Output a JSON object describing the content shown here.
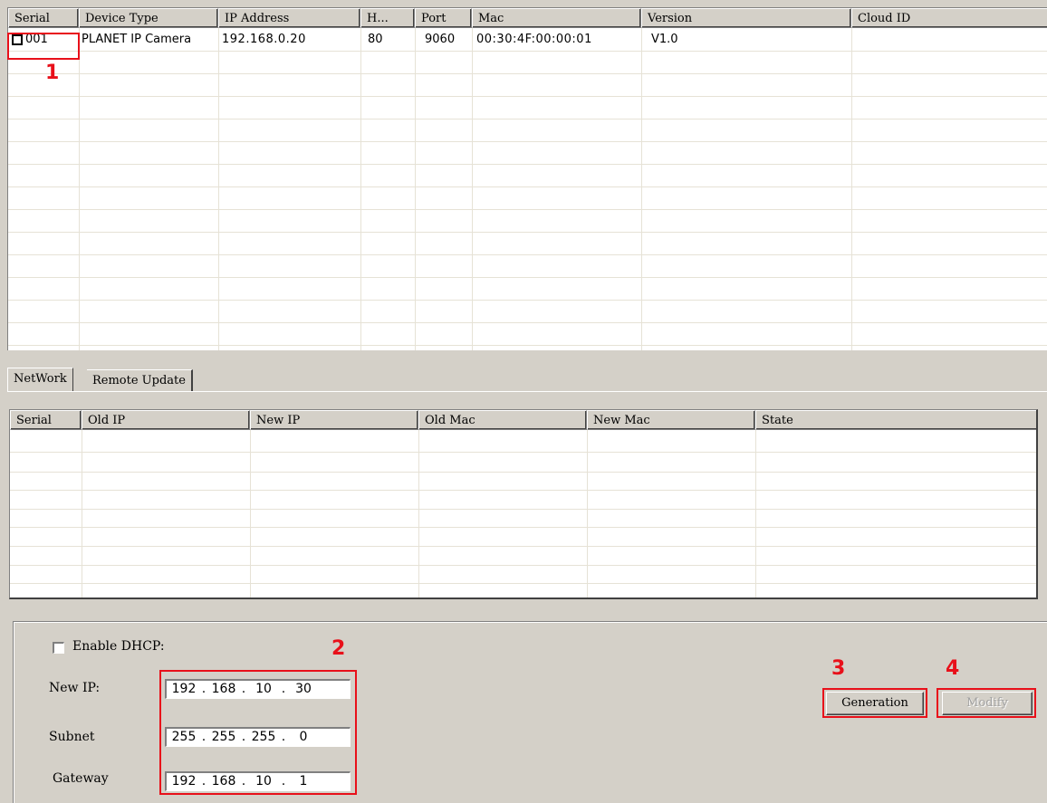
{
  "device_list": {
    "columns": [
      "Serial",
      "Device Type",
      "IP Address",
      "H...",
      "Port",
      "Mac",
      "Version",
      "Cloud ID"
    ],
    "rows": [
      {
        "serial": "001",
        "device_type": "PLANET IP Camera",
        "ip_address": "192.168.0.20",
        "http": "80",
        "port": "9060",
        "mac": "00:30:4F:00:00:01",
        "version": "V1.0",
        "cloud_id": ""
      }
    ]
  },
  "tabs": [
    {
      "label": "NetWork",
      "active": true
    },
    {
      "label": "Remote Update",
      "active": false
    }
  ],
  "task_list": {
    "columns": [
      "Serial",
      "Old IP",
      "New IP",
      "Old Mac",
      "New Mac",
      "State"
    ],
    "rows": []
  },
  "settings": {
    "enable_dhcp_label": "Enable DHCP:",
    "enable_dhcp_checked": false,
    "new_ip_label": "New IP:",
    "new_ip": [
      "192",
      "168",
      "10",
      "30"
    ],
    "subnet_label": "Subnet",
    "subnet": [
      "255",
      "255",
      "255",
      "0"
    ],
    "gateway_label": "Gateway",
    "gateway": [
      "192",
      "168",
      "10",
      "1"
    ],
    "generation_label": "Generation",
    "modify_label": "Modify"
  },
  "annotations": {
    "step1": "1",
    "step2": "2",
    "step3": "3",
    "step4": "4",
    "color": "#e8101a"
  }
}
